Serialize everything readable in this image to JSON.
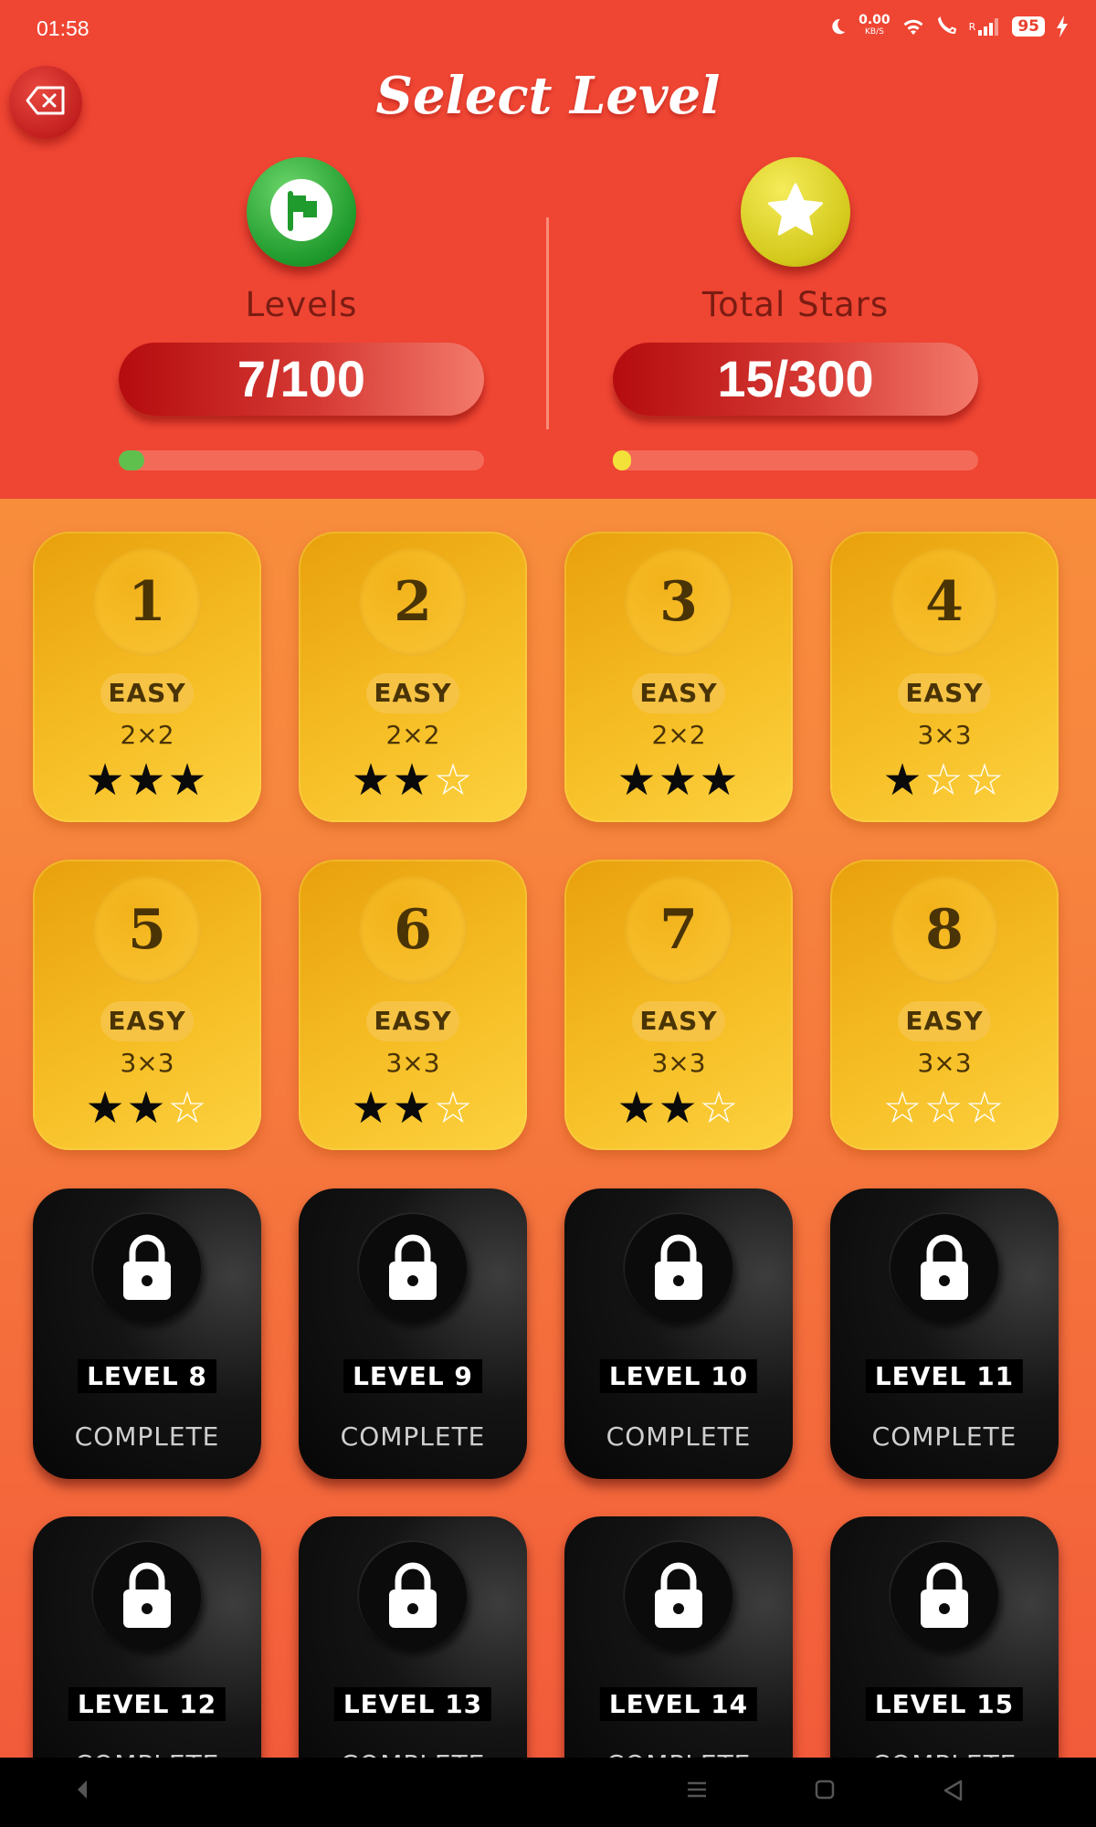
{
  "status_bar": {
    "time": "01:58",
    "net_speed": "0.00",
    "net_unit": "KB/S",
    "signal_label": "R",
    "battery": "95"
  },
  "header": {
    "title": "Select Level",
    "back_icon": "backspace-icon",
    "levels": {
      "label": "Levels",
      "value": "7/100",
      "progress": 0.07,
      "icon": "flag-icon"
    },
    "stars": {
      "label": "Total Stars",
      "value": "15/300",
      "progress": 0.05,
      "icon": "star-icon"
    }
  },
  "levels": [
    {
      "number": "1",
      "difficulty": "EASY",
      "size": "2×2",
      "stars": 3
    },
    {
      "number": "2",
      "difficulty": "EASY",
      "size": "2×2",
      "stars": 2
    },
    {
      "number": "3",
      "difficulty": "EASY",
      "size": "2×2",
      "stars": 3
    },
    {
      "number": "4",
      "difficulty": "EASY",
      "size": "3×3",
      "stars": 1
    },
    {
      "number": "5",
      "difficulty": "EASY",
      "size": "3×3",
      "stars": 2
    },
    {
      "number": "6",
      "difficulty": "EASY",
      "size": "3×3",
      "stars": 2
    },
    {
      "number": "7",
      "difficulty": "EASY",
      "size": "3×3",
      "stars": 2
    },
    {
      "number": "8",
      "difficulty": "EASY",
      "size": "3×3",
      "stars": 0
    }
  ],
  "locked": [
    {
      "requirement": "LEVEL 8",
      "status": "COMPLETE"
    },
    {
      "requirement": "LEVEL 9",
      "status": "COMPLETE"
    },
    {
      "requirement": "LEVEL 10",
      "status": "COMPLETE"
    },
    {
      "requirement": "LEVEL 11",
      "status": "COMPLETE"
    },
    {
      "requirement": "LEVEL 12",
      "status": "COMPLETE"
    },
    {
      "requirement": "LEVEL 13",
      "status": "COMPLETE"
    },
    {
      "requirement": "LEVEL 14",
      "status": "COMPLETE"
    },
    {
      "requirement": "LEVEL 15",
      "status": "COMPLETE"
    }
  ],
  "colors": {
    "header_bg": "#ef4533",
    "card_gold": "#f6bd24",
    "locked_card": "#111111",
    "levels_progress": "#5fc04e",
    "stars_progress": "#f3e13a"
  },
  "nav": {
    "back_icon": "nav-back-icon",
    "menu_icon": "menu-icon",
    "home_icon": "home-icon",
    "recents_icon": "triangle-back-icon"
  }
}
